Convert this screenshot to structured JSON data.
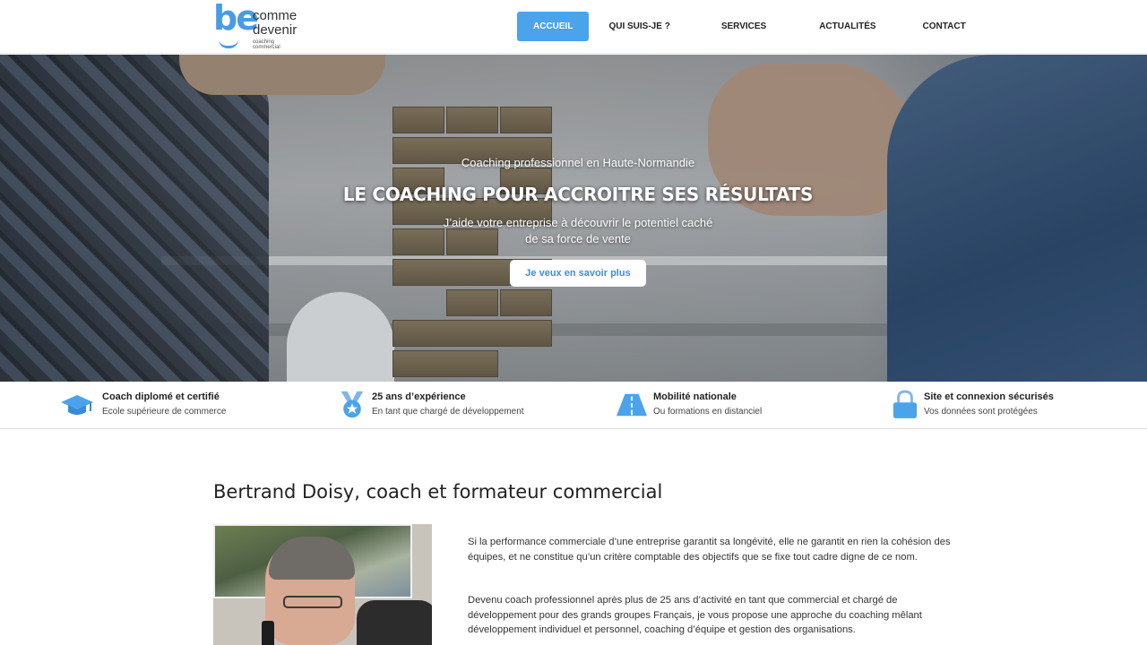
{
  "header": {
    "logo": {
      "mark": "be",
      "line1": "comme",
      "line2": "devenir",
      "tagline": "coaching commercial"
    },
    "nav": [
      {
        "label": "ACCUEIL",
        "active": true
      },
      {
        "label": "QUI SUIS-JE ?",
        "active": false
      },
      {
        "label": "SERVICES",
        "active": false
      },
      {
        "label": "ACTUALITÉS",
        "active": false
      },
      {
        "label": "CONTACT",
        "active": false
      }
    ]
  },
  "hero": {
    "subtitle": "Coaching professionnel en Haute-Normandie",
    "title": "LE COACHING POUR ACCROITRE SES RÉSULTATS",
    "text_line1": "J’aide votre entreprise à découvrir le potentiel caché",
    "text_line2": "de sa force de vente",
    "cta_label": "Je veux en savoir plus"
  },
  "features": [
    {
      "icon": "graduation-cap-icon",
      "title": "Coach diplomé et certifié",
      "desc": "Ecole supérieure de commerce"
    },
    {
      "icon": "medal-icon",
      "title": "25 ans d’expérience",
      "desc": "En tant que chargé de développement"
    },
    {
      "icon": "road-icon",
      "title": "Mobilité nationale",
      "desc": "Ou formations en distanciel"
    },
    {
      "icon": "lock-icon",
      "title": "Site et connexion sécurisés",
      "desc": "Vos données sont protégées"
    }
  ],
  "about": {
    "title": "Bertrand Doisy, coach et formateur commercial",
    "paragraph1": "Si la performance commerciale d’une entreprise garantit sa longévité, elle ne garantit en rien la cohésion des équipes, et ne constitue qu’un critère comptable des objectifs que se fixe tout cadre digne de ce nom.",
    "paragraph2": "Devenu coach professionnel après plus de 25 ans d’activité en tant que commercial et chargé de développement pour des grands groupes Français, je vous propose une approche du coaching mêlant développement individuel et personnel, coaching d’équipe et gestion des organisations."
  },
  "colors": {
    "accent": "#4ba3ec",
    "logo": "#4a9be6",
    "cta_text": "#3c8fdb"
  }
}
